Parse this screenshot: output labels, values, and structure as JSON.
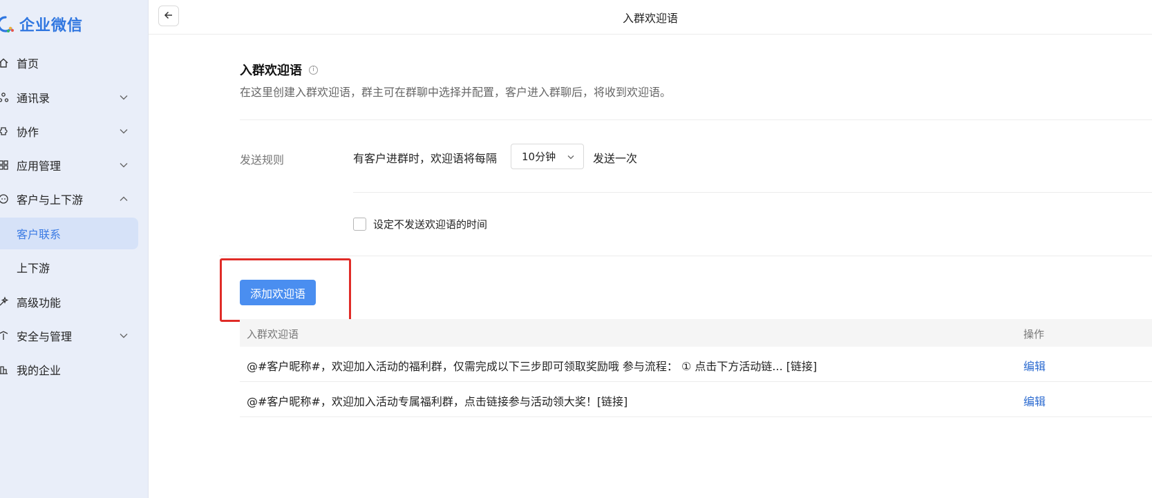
{
  "app": {
    "logo_text": "企业微信"
  },
  "sidebar": {
    "items": [
      {
        "label": "首页",
        "icon": "home-icon"
      },
      {
        "label": "通讯录",
        "icon": "contacts-icon",
        "expand": "down"
      },
      {
        "label": "协作",
        "icon": "collaboration-icon",
        "expand": "down"
      },
      {
        "label": "应用管理",
        "icon": "apps-icon",
        "expand": "down"
      },
      {
        "label": "客户与上下游",
        "icon": "customer-chat-icon",
        "expand": "up"
      },
      {
        "label": "客户联系",
        "active": true
      },
      {
        "label": "上下游"
      },
      {
        "label": "高级功能",
        "icon": "advanced-icon"
      },
      {
        "label": "安全与管理",
        "icon": "security-icon",
        "expand": "down"
      },
      {
        "label": "我的企业",
        "icon": "enterprise-icon"
      }
    ]
  },
  "header": {
    "title": "入群欢迎语"
  },
  "main": {
    "section_title": "入群欢迎语",
    "section_desc": "在这里创建入群欢迎语，群主可在群聊中选择并配置，客户进入群聊后，将收到欢迎语。",
    "rule": {
      "label": "发送规则",
      "text_before": "有客户进群时，欢迎语将每隔",
      "interval_value": "10分钟",
      "text_after": "发送一次"
    },
    "no_send_checkbox": {
      "label": "设定不发送欢迎语的时间",
      "checked": false
    },
    "add_button": "添加欢迎语",
    "table": {
      "headers": [
        "入群欢迎语",
        "操作"
      ],
      "rows": [
        {
          "message": "@#客户昵称#，欢迎加入活动的福利群，仅需完成以下三步即可领取奖励哦 参与流程： ① 点击下方活动链... [链接]",
          "action": "编辑"
        },
        {
          "message": "@#客户昵称#，欢迎加入活动专属福利群，点击链接参与活动领大奖！[链接]",
          "action": "编辑"
        }
      ]
    }
  },
  "colors": {
    "accent": "#4a8ef0",
    "link": "#2c6bd0",
    "highlight": "#e02b27",
    "sidebar_bg": "#e9eef9"
  }
}
